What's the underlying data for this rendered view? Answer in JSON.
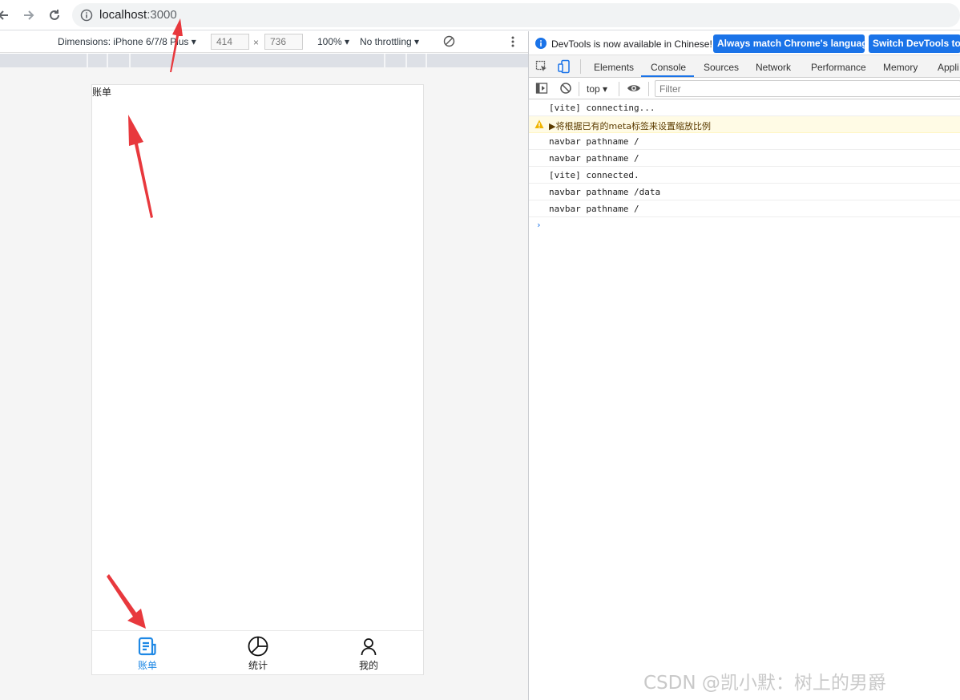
{
  "browser": {
    "url_host": "localhost",
    "url_port": ":3000"
  },
  "device_toolbar": {
    "dimensions_label": "Dimensions: iPhone 6/7/8 Plus",
    "width": "414",
    "height": "736",
    "times": "×",
    "zoom": "100%",
    "throttling": "No throttling"
  },
  "app": {
    "page_title": "账单",
    "tabs": [
      {
        "label": "账单",
        "icon": "bill-icon",
        "active": true
      },
      {
        "label": "统计",
        "icon": "pie-chart-icon",
        "active": false
      },
      {
        "label": "我的",
        "icon": "user-icon",
        "active": false
      }
    ],
    "accent_color": "#1e88e5"
  },
  "devtools": {
    "info_message": "DevTools is now available in Chinese!",
    "match_language_button": "Always match Chrome's language",
    "switch_button": "Switch DevTools to C",
    "tabs": [
      "Elements",
      "Console",
      "Sources",
      "Network",
      "Performance",
      "Memory",
      "Appli"
    ],
    "selected_tab": "Console",
    "context": "top",
    "filter_placeholder": "Filter",
    "console_lines": [
      {
        "text": "[vite] connecting...",
        "level": "log"
      },
      {
        "text": "▶将根据已有的meta标签来设置缩放比例",
        "level": "warn"
      },
      {
        "text": "navbar pathname /",
        "level": "log"
      },
      {
        "text": "navbar pathname /",
        "level": "log"
      },
      {
        "text": "[vite] connected.",
        "level": "log"
      },
      {
        "text": "navbar pathname /data",
        "level": "log"
      },
      {
        "text": "navbar pathname /",
        "level": "log"
      }
    ],
    "prompt": "›"
  },
  "watermark": "CSDN @凯小默：树上的男爵",
  "colors": {
    "arrow": "#e8383d",
    "devtools_button": "#1a73e8"
  }
}
